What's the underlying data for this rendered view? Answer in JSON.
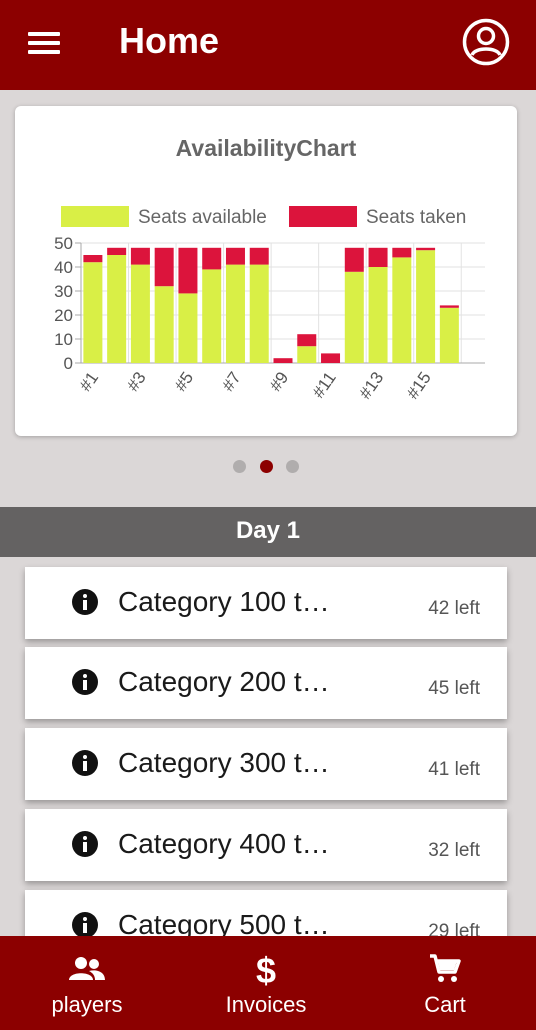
{
  "header": {
    "title": "Home",
    "menu_icon": "menu-icon",
    "profile_icon": "account-circle-icon"
  },
  "chart": {
    "title": "AvailabilityChart",
    "pager": {
      "total": 3,
      "active": 1
    }
  },
  "chart_data": {
    "type": "bar",
    "stacked": true,
    "categories": [
      "#1",
      "#2",
      "#3",
      "#4",
      "#5",
      "#6",
      "#7",
      "#8",
      "#9",
      "#10",
      "#11",
      "#12",
      "#13",
      "#14",
      "#15",
      "#16",
      "#17"
    ],
    "tick_labels": [
      "#1",
      "#3",
      "#5",
      "#7",
      "#9",
      "#11",
      "#13",
      "#15"
    ],
    "series": [
      {
        "name": "Seats available",
        "color": "#d9ef46",
        "values": [
          42,
          45,
          41,
          32,
          29,
          39,
          41,
          41,
          0,
          7,
          0,
          38,
          40,
          44,
          47,
          23,
          0
        ]
      },
      {
        "name": "Seats taken",
        "color": "#dc143c",
        "values": [
          3,
          3,
          7,
          16,
          19,
          9,
          7,
          7,
          2,
          5,
          4,
          10,
          8,
          4,
          1,
          1,
          0
        ]
      }
    ],
    "ylim": [
      0,
      50
    ],
    "yticks": [
      0,
      10,
      20,
      30,
      40,
      50
    ],
    "grid": true,
    "legend": "top"
  },
  "section": {
    "title": "Day 1"
  },
  "categories": [
    {
      "name": "Category 100 t…",
      "left": "42 left"
    },
    {
      "name": "Category 200 t…",
      "left": "45 left"
    },
    {
      "name": "Category 300 t…",
      "left": "41 left"
    },
    {
      "name": "Category 400 t…",
      "left": "32 left"
    },
    {
      "name": "Category 500 t…",
      "left": "29 left"
    }
  ],
  "bottom_nav": [
    {
      "label": "players",
      "icon": "people-icon"
    },
    {
      "label": "Invoices",
      "icon": "dollar-icon"
    },
    {
      "label": "Cart",
      "icon": "cart-icon"
    }
  ],
  "colors": {
    "primary": "#8c0000",
    "section_header": "#646262",
    "background": "#dbd7d7"
  }
}
